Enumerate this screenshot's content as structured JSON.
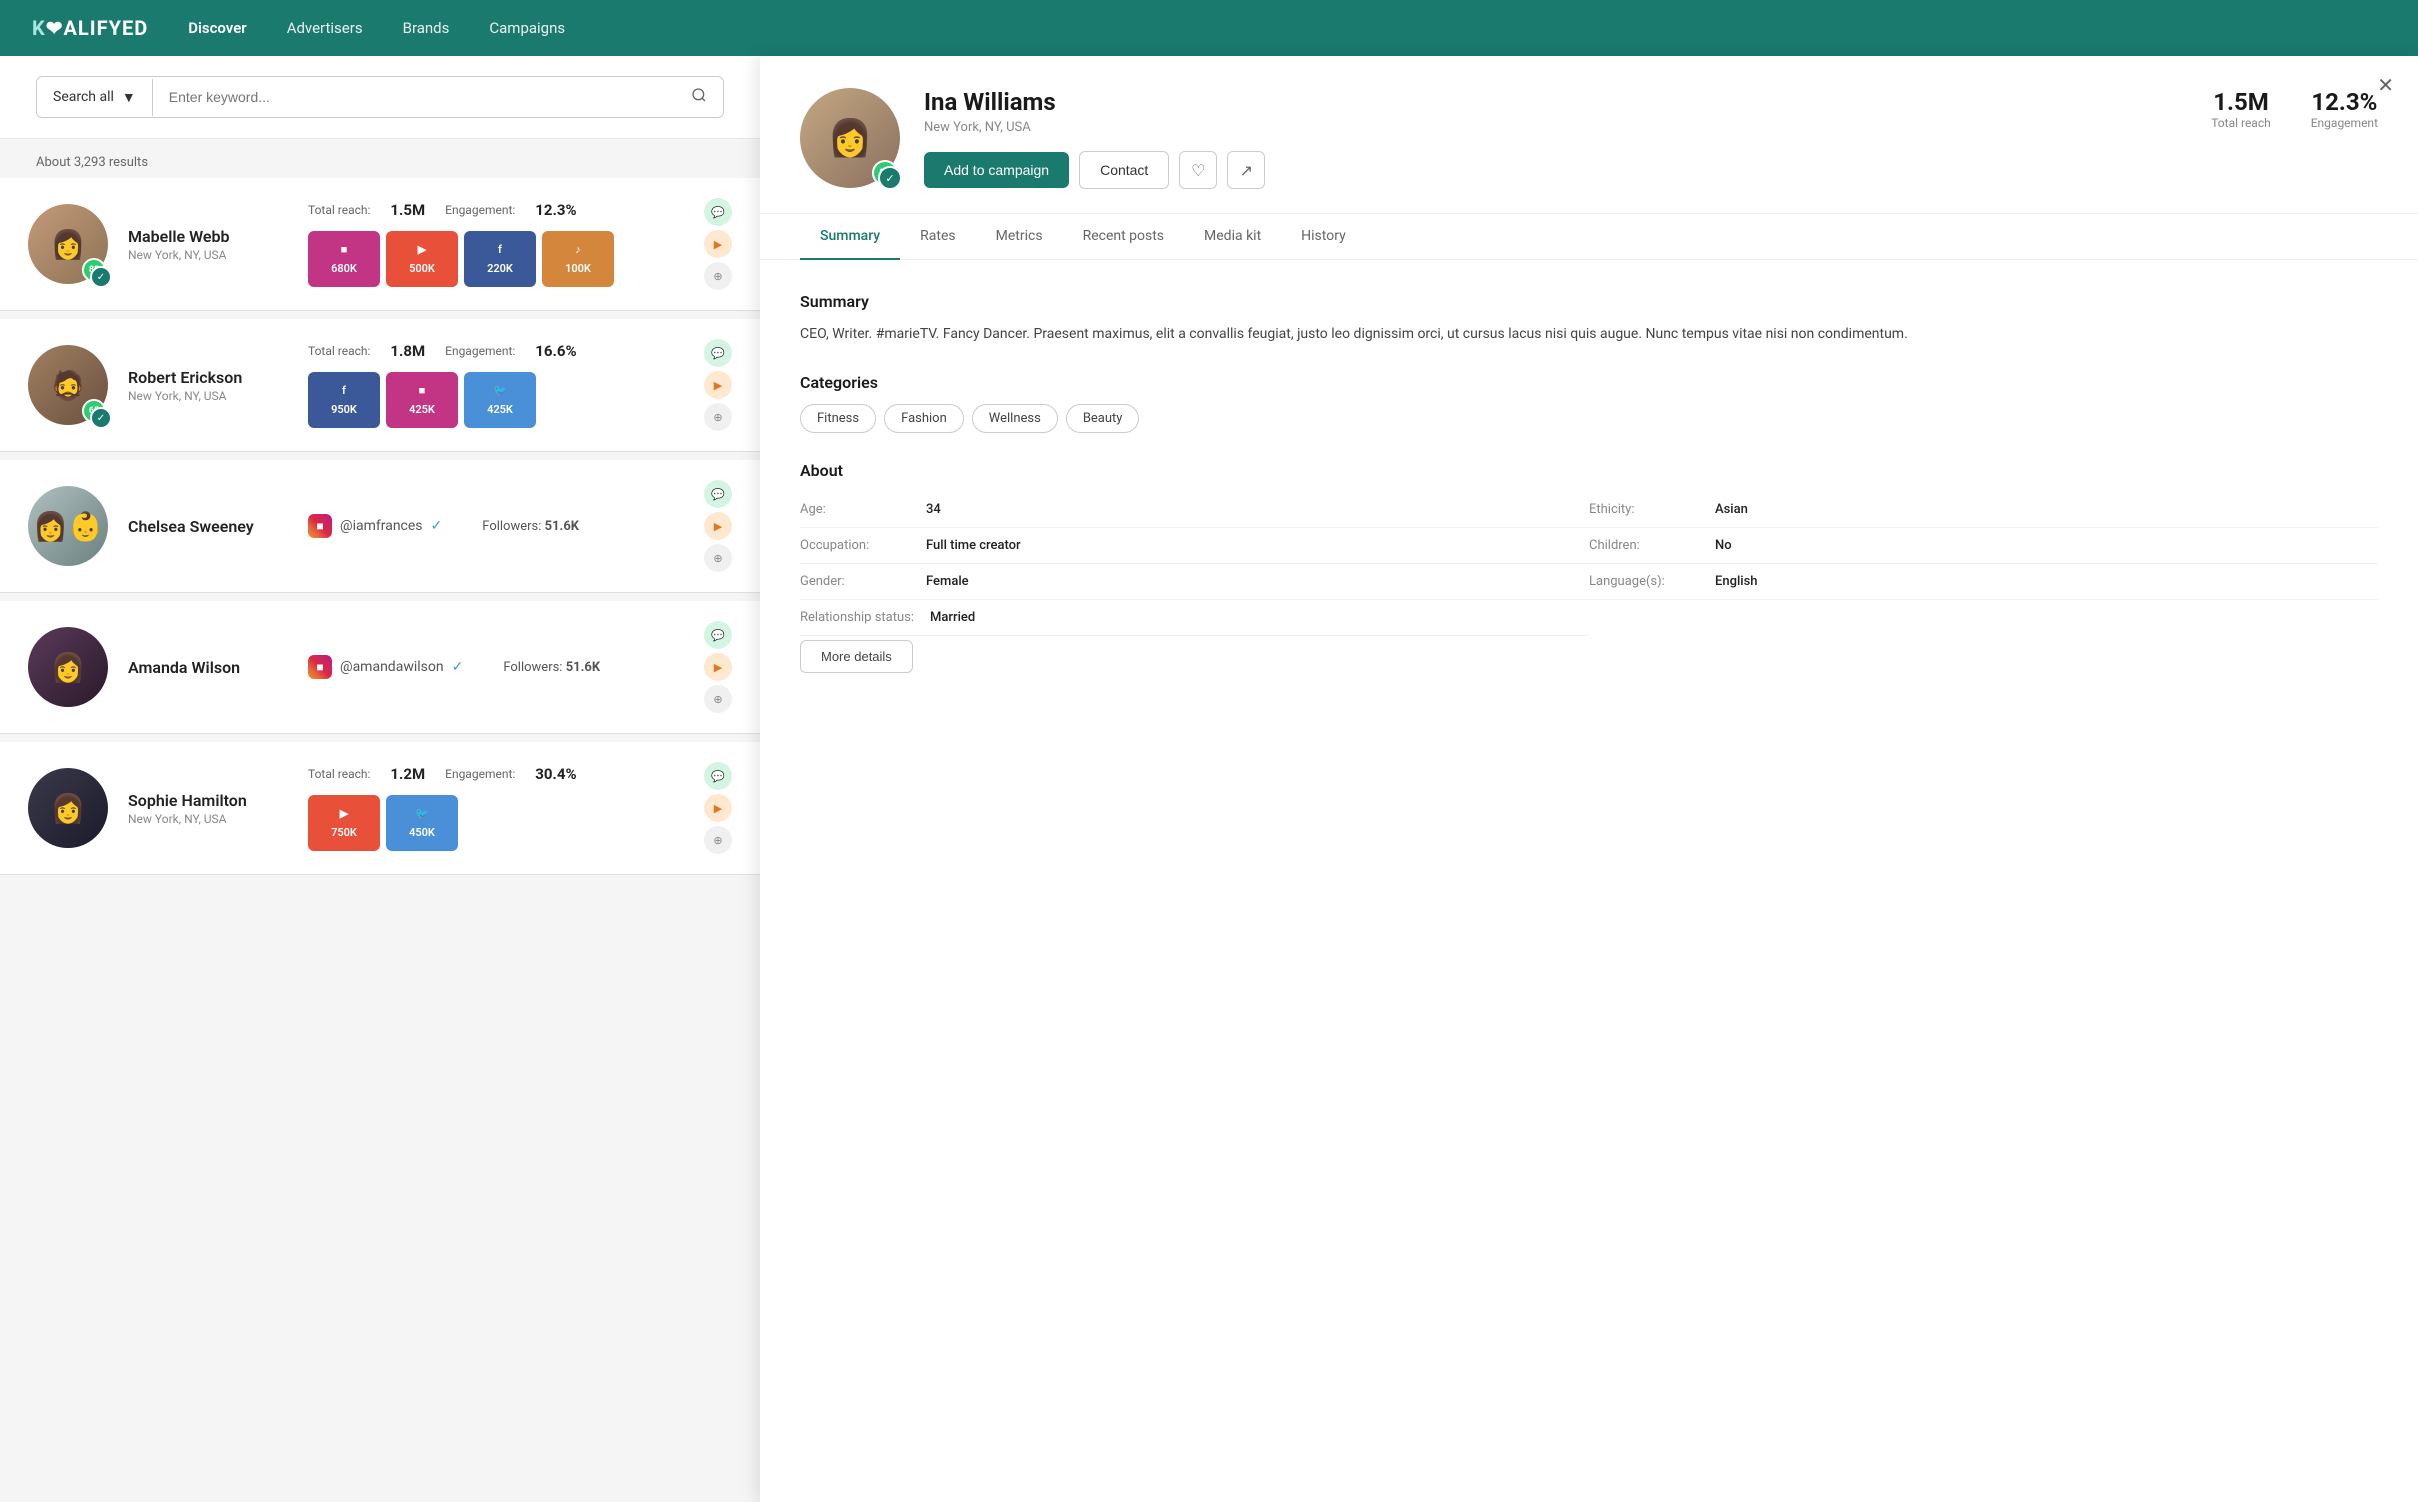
{
  "app": {
    "logo": "KOALIFYED",
    "nav_items": [
      "Discover",
      "Advertisers",
      "Brands",
      "Campaigns"
    ]
  },
  "search": {
    "dropdown_label": "Search all",
    "placeholder": "Enter keyword...",
    "results_count": "About 3,293 results"
  },
  "influencers": [
    {
      "id": 1,
      "name": "Mabelle Webb",
      "location": "New York, NY, USA",
      "badge": "80",
      "total_reach_label": "Total reach:",
      "total_reach": "1.5M",
      "engagement_label": "Engagement:",
      "engagement": "12.3%",
      "platforms": [
        {
          "name": "Instagram",
          "icon": "instagram",
          "count": "680K",
          "class": "instagram"
        },
        {
          "name": "YouTube",
          "icon": "youtube",
          "count": "500K",
          "class": "youtube"
        },
        {
          "name": "Facebook",
          "icon": "facebook",
          "count": "220K",
          "class": "facebook"
        },
        {
          "name": "Spotify",
          "icon": "spotify",
          "count": "100K",
          "class": "spotify"
        }
      ]
    },
    {
      "id": 2,
      "name": "Robert Erickson",
      "location": "New York, NY, USA",
      "badge": "65",
      "total_reach_label": "Total reach:",
      "total_reach": "1.8M",
      "engagement_label": "Engagement:",
      "engagement": "16.6%",
      "platforms": [
        {
          "name": "Facebook",
          "icon": "facebook",
          "count": "950K",
          "class": "facebook"
        },
        {
          "name": "Instagram",
          "icon": "instagram",
          "count": "425K",
          "class": "instagram"
        },
        {
          "name": "Twitter",
          "icon": "twitter",
          "count": "425K",
          "class": "twitter"
        }
      ]
    },
    {
      "id": 3,
      "name": "Chelsea Sweeney",
      "location": "",
      "handle": "@iamfrances",
      "followers_label": "Followers:",
      "followers": "51.6K"
    },
    {
      "id": 4,
      "name": "Amanda Wilson",
      "location": "",
      "handle": "@amandawilson",
      "followers_label": "Followers:",
      "followers": "51.6K"
    },
    {
      "id": 5,
      "name": "Sophie Hamilton",
      "location": "New York, NY, USA",
      "badge": "",
      "total_reach_label": "Total reach:",
      "total_reach": "1.2M",
      "engagement_label": "Engagement:",
      "engagement": "30.4%",
      "platforms": [
        {
          "name": "YouTube",
          "icon": "youtube",
          "count": "750K",
          "class": "youtube"
        },
        {
          "name": "Twitter",
          "icon": "twitter",
          "count": "450K",
          "class": "twitter"
        }
      ]
    }
  ],
  "profile": {
    "name": "Ina Williams",
    "location": "New York, NY, USA",
    "badge": "80",
    "total_reach_label": "Total reach",
    "total_reach": "1.5M",
    "engagement_label": "Engagement",
    "engagement": "12.3%",
    "actions": {
      "add_campaign": "Add to campaign",
      "contact": "Contact"
    },
    "tabs": [
      "Summary",
      "Rates",
      "Metrics",
      "Recent posts",
      "Media kit",
      "History"
    ],
    "active_tab": "Summary",
    "summary": {
      "title": "Summary",
      "text": "CEO, Writer. #marieTV. Fancy Dancer. Praesent maximus, elit a convallis feugiat, justo leo dignissim orci, ut cursus lacus nisi quis augue. Nunc tempus vitae nisi non condimentum."
    },
    "categories": {
      "title": "Categories",
      "items": [
        "Fitness",
        "Fashion",
        "Wellness",
        "Beauty"
      ]
    },
    "about": {
      "title": "About",
      "fields": [
        {
          "label": "Age:",
          "value": "34"
        },
        {
          "label": "Occupation:",
          "value": "Full time creator"
        },
        {
          "label": "Gender:",
          "value": "Female"
        },
        {
          "label": "Relationship status:",
          "value": "Married"
        },
        {
          "label": "Ethicity:",
          "value": "Asian"
        },
        {
          "label": "Children:",
          "value": "No"
        },
        {
          "label": "Language(s):",
          "value": "English"
        }
      ],
      "more_details_btn": "More details"
    }
  }
}
